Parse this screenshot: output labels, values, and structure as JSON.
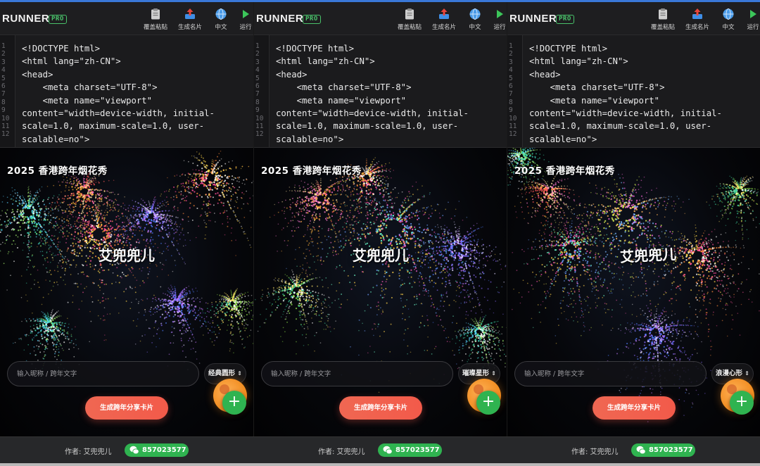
{
  "app": {
    "brand": "RUNNER",
    "badge": "PRO"
  },
  "toolbar": [
    {
      "label": "覆盖粘贴",
      "icon": "clipboard-icon"
    },
    {
      "label": "生成名片",
      "icon": "upload-tray-icon"
    },
    {
      "label": "中文",
      "icon": "globe-icon"
    },
    {
      "label": "运行",
      "icon": "play-icon"
    }
  ],
  "code": {
    "line_numbers": [
      "1",
      "2",
      "3",
      "4",
      "5",
      "6",
      "7",
      "8",
      "9",
      "10",
      "11",
      "12"
    ],
    "lines": [
      "<!DOCTYPE html>",
      "<html lang=\"zh-CN\">",
      "<head>",
      "    <meta charset=\"UTF-8\">",
      "    <meta name=\"viewport\"",
      "content=\"width=device-width, initial-",
      "scale=1.0, maximum-scale=1.0, user-",
      "scalable=no\">"
    ]
  },
  "panels": [
    {
      "title": "2025 香港跨年烟花秀",
      "name_text": "艾兜兜儿",
      "shape": "经典圆形"
    },
    {
      "title": "2025 香港跨年烟花秀",
      "name_text": "艾兜兜儿",
      "shape": "璀璨星形"
    },
    {
      "title": "2025 香港跨年烟花秀",
      "name_text": "艾兜兜儿",
      "shape": "浪漫心形"
    }
  ],
  "controls": {
    "input_placeholder": "输入昵称 / 跨年文字",
    "generate_button": "生成跨年分享卡片",
    "add_button": "+"
  },
  "footer": {
    "author": "作者: 艾兜兜儿",
    "wechat": "857023577"
  },
  "colors": {
    "accent_green": "#2fb350",
    "generate_red": "#f25a4a",
    "orange_fab": "#f08a1c",
    "top_bar": "#3a78d8"
  }
}
